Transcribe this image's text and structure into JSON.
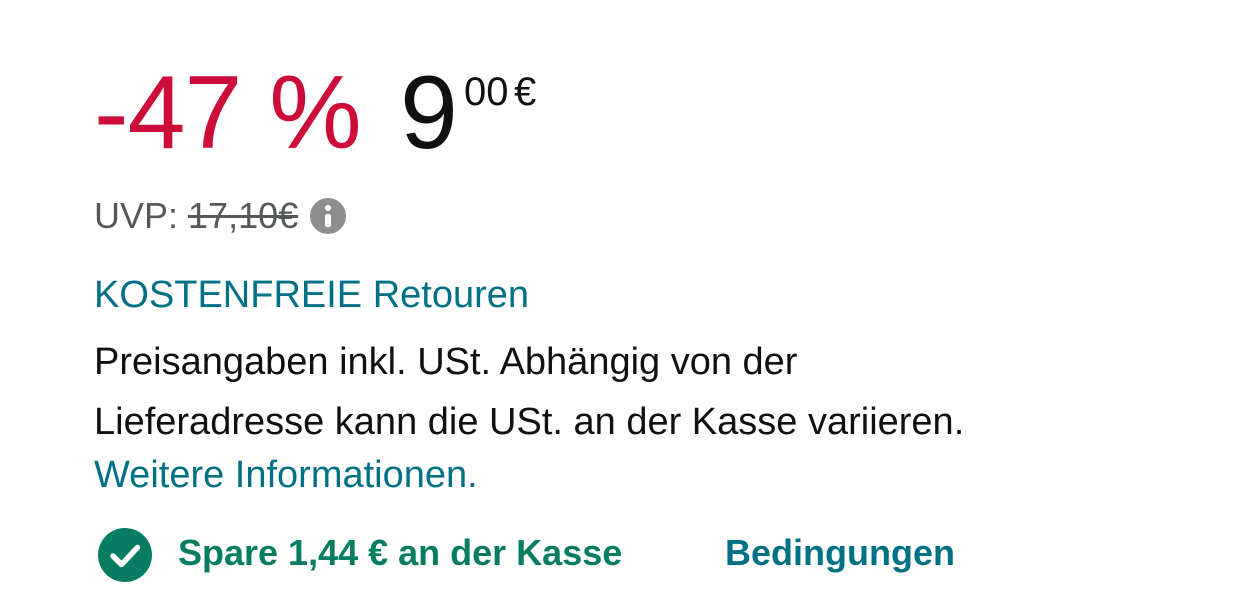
{
  "price": {
    "discount": "-47 %",
    "whole": "9",
    "fraction": "00",
    "currency": "€"
  },
  "uvp": {
    "label": "UVP:",
    "value": "17,10€",
    "icon": "info-icon"
  },
  "returns": {
    "label": "KOSTENFREIE Retouren"
  },
  "tax_note": {
    "line1": "Preisangaben inkl. USt. Abhängig von der",
    "line2": "Lieferadresse kann die USt. an der Kasse variieren."
  },
  "more_info": {
    "label": "Weitere Informationen."
  },
  "coupon": {
    "icon": "check-circle-icon",
    "text": "Spare 1,44 € an der Kasse",
    "terms_label": "Bedingungen"
  },
  "colors": {
    "discount": "#cc0c39",
    "link": "#007185",
    "coupon_green": "#067d62",
    "muted": "#565959"
  }
}
